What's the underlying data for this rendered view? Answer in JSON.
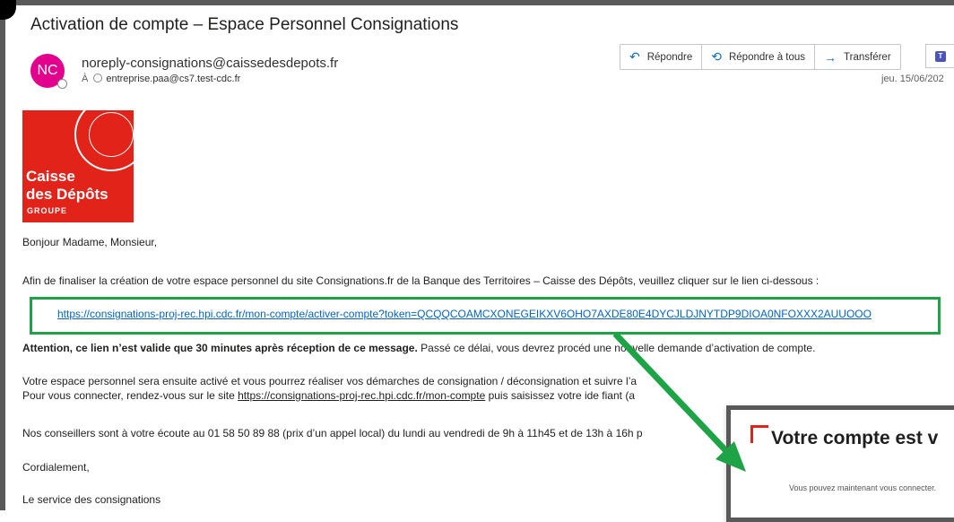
{
  "email": {
    "subject": "Activation de compte – Espace Personnel Consignations",
    "avatar_initials": "NC",
    "sender": "noreply-consignations@caissedesdepots.fr",
    "to_label": "À",
    "recipient": "entreprise.paa@cs7.test-cdc.fr",
    "date": "jeu. 15/06/202",
    "actions": [
      {
        "label": "Répondre",
        "icon": "reply-icon"
      },
      {
        "label": "Répondre à tous",
        "icon": "reply-all-icon"
      },
      {
        "label": "Transférer",
        "icon": "forward-icon"
      }
    ],
    "teams_icon": "teams-icon"
  },
  "logo": {
    "line1": "Caisse",
    "line2": "des Dépôts",
    "line3": "GROUPE",
    "brand_color": "#e2231a"
  },
  "body": {
    "greeting": "Bonjour Madame, Monsieur,",
    "intro": "Afin de finaliser la création de votre espace personnel du site Consignations.fr de la Banque des Territoires – Caisse des Dépôts, veuillez cliquer sur le lien ci-dessous :",
    "activation_link": "https://consignations-proj-rec.hpi.cdc.fr/mon-compte/activer-compte?token=QCQQCOAMCXONEGEIKXV6OHO7AXDE80E4DYCJLDJNYTDP9DIOA0NFOXXX2AUUOOO",
    "warning_bold": "Attention, ce lien n’est valide que 30 minutes après réception de ce message.",
    "warning_rest": " Passé ce délai, vous devrez procéd   une nouvelle demande d’activation de compte.",
    "para1_line1": "Votre espace personnel sera ensuite activé et vous pourrez réaliser vos démarches de consignation / déconsignation et   suivre l’a",
    "para1_line2_pre": "Pour vous connecter, rendez-vous sur le site ",
    "para1_line2_link": "https://consignations-proj-rec.hpi.cdc.fr/mon-compte",
    "para1_line2_post": " puis saisissez votre ide   fiant (a",
    "contact": "Nos conseillers sont à votre écoute au 01 58 50 89 88 (prix d’un appel local) du lundi au vendredi de 9h à 11h45 et de 13h à 16h p",
    "closing": "Cordialement,",
    "signature": "Le service des consignations"
  },
  "popup": {
    "title": "Votre compte est v",
    "subtitle": "Vous pouvez maintenant vous connecter."
  },
  "colors": {
    "highlight_box": "#1ea347",
    "arrow": "#1ea347",
    "link": "#0563c1"
  }
}
